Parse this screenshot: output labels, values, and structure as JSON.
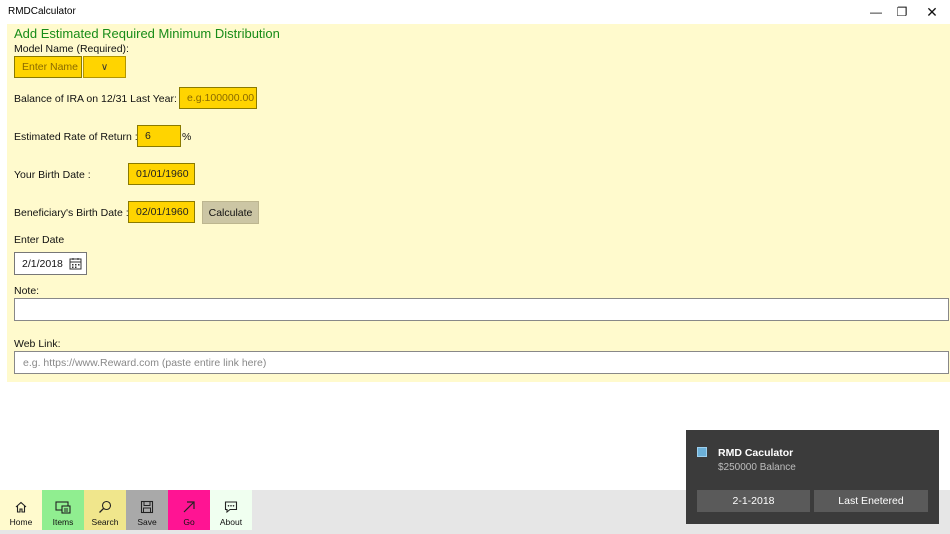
{
  "window": {
    "title": "RMDCalculator",
    "minimize": "—",
    "maximize": "❐",
    "close": "✕"
  },
  "form": {
    "heading": "Add Estimated Required Minimum Distribution",
    "model_label": "Model Name (Required):",
    "model_placeholder": "Enter Name",
    "model_dropdown_arrow": "∨",
    "balance_label": "Balance of IRA on 12/31 Last Year: $",
    "balance_placeholder": "e.g.100000.00",
    "rate_label": "Estimated Rate of Return :",
    "rate_value": "6",
    "rate_unit": "%",
    "birth_label": "Your Birth Date :",
    "birth_value": "01/01/1960",
    "beneficiary_label": "Beneficiary's Birth Date :",
    "beneficiary_value": "02/01/1960",
    "calculate_label": "Calculate",
    "enter_date_label": "Enter Date",
    "enter_date_value": "2/1/2018",
    "note_label": "Note:",
    "note_value": "",
    "weblink_label": "Web Link:",
    "weblink_placeholder": "e.g. https://www.Reward.com (paste entire link here)"
  },
  "appbar": {
    "buttons": [
      {
        "label": "Home",
        "icon": "home-icon",
        "color": "#fffacd"
      },
      {
        "label": "Items",
        "icon": "items-icon",
        "color": "#90ee90"
      },
      {
        "label": "Search",
        "icon": "search-icon",
        "color": "#f0e68c"
      },
      {
        "label": "Save",
        "icon": "save-icon",
        "color": "#a9a9a9"
      },
      {
        "label": "Go",
        "icon": "go-arrow-icon",
        "color": "#ff1493"
      },
      {
        "label": "About",
        "icon": "chat-icon",
        "color": "#f0fff0"
      }
    ]
  },
  "toast": {
    "title": "RMD Caculator",
    "body": "$250000 Balance",
    "button1": "2-1-2018",
    "button2": "Last Enetered"
  }
}
